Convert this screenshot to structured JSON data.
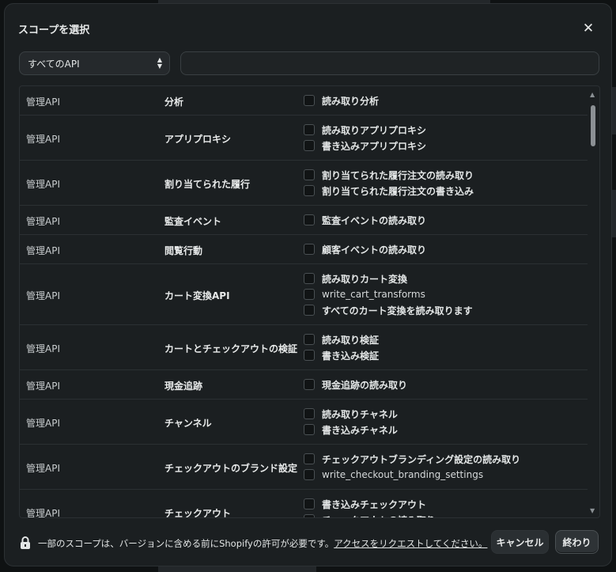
{
  "modal": {
    "title": "スコープを選択",
    "close_symbol": "✕"
  },
  "filter": {
    "selected": "すべてのAPI",
    "search_value": "",
    "search_placeholder": ""
  },
  "rows": [
    {
      "api": "管理API",
      "category": "分析",
      "scopes": [
        "読み取り分析"
      ]
    },
    {
      "api": "管理API",
      "category": "アプリプロキシ",
      "scopes": [
        "読み取りアプリプロキシ",
        "書き込みアプリプロキシ"
      ]
    },
    {
      "api": "管理API",
      "category": "割り当てられた履行",
      "scopes": [
        "割り当てられた履行注文の読み取り",
        "割り当てられた履行注文の書き込み"
      ]
    },
    {
      "api": "管理API",
      "category": "監査イベント",
      "scopes": [
        "監査イベントの読み取り"
      ]
    },
    {
      "api": "管理API",
      "category": "閲覧行動",
      "scopes": [
        "顧客イベントの読み取り"
      ]
    },
    {
      "api": "管理API",
      "category": "カート変換API",
      "scopes": [
        "読み取りカート変換",
        "write_cart_transforms",
        "すべてのカート変換を読み取ります"
      ]
    },
    {
      "api": "管理API",
      "category": "カートとチェックアウトの検証",
      "scopes": [
        "読み取り検証",
        "書き込み検証"
      ]
    },
    {
      "api": "管理API",
      "category": "現金追跡",
      "scopes": [
        "現金追跡の読み取り"
      ]
    },
    {
      "api": "管理API",
      "category": "チャンネル",
      "scopes": [
        "読み取りチャネル",
        "書き込みチャネル"
      ]
    },
    {
      "api": "管理API",
      "category": "チェックアウトのブランド設定",
      "scopes": [
        "チェックアウトブランディング設定の読み取り",
        "write_checkout_branding_settings"
      ]
    },
    {
      "api": "管理API",
      "category": "チェックアウト",
      "scopes": [
        "書き込みチェックアウト",
        "チェックアウトの読み取り"
      ]
    }
  ],
  "footer": {
    "notice_prefix": "一部のスコープは、バージョンに含める前にShopifyの許可が必要です。",
    "notice_link": "アクセスをリクエストしてください。",
    "cancel_label": "キャンセル",
    "done_label": "終わり"
  },
  "icons": {
    "close": "close-icon",
    "lock": "lock-icon",
    "external": "external-link-icon",
    "select": "chevron-updown-icon"
  },
  "colors": {
    "modal_bg": "#1b1f21",
    "border": "#2b3033",
    "text": "#e3e6e6"
  }
}
